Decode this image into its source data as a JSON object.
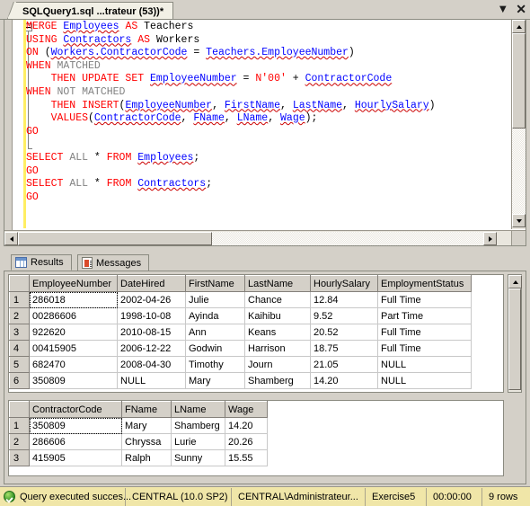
{
  "tab": {
    "title": "SQLQuery1.sql ...trateur (53))*",
    "dropdown_icon": "chevron-down-icon",
    "close_icon": "close-icon"
  },
  "editor": {
    "lines": [
      [
        {
          "t": "MERGE ",
          "c": "kw"
        },
        {
          "t": "Employees",
          "c": "id wavy-blue"
        },
        {
          "t": " AS ",
          "c": "kw"
        },
        {
          "t": "Teachers",
          "c": "op"
        }
      ],
      [
        {
          "t": "USING ",
          "c": "kw"
        },
        {
          "t": "Contractors",
          "c": "id wavy-blue"
        },
        {
          "t": " AS ",
          "c": "kw"
        },
        {
          "t": "Workers",
          "c": "op"
        }
      ],
      [
        {
          "t": "ON ",
          "c": "kw"
        },
        {
          "t": "(",
          "c": "op"
        },
        {
          "t": "Workers.ContractorCode",
          "c": "id wavy-blue"
        },
        {
          "t": " = ",
          "c": "op"
        },
        {
          "t": "Teachers.EmployeeNumber",
          "c": "id wavy-blue"
        },
        {
          "t": ")",
          "c": "op"
        }
      ],
      [
        {
          "t": "WHEN ",
          "c": "kw"
        },
        {
          "t": "MATCHED",
          "c": "kw2"
        }
      ],
      [
        {
          "t": "    THEN UPDATE SET ",
          "c": "kw"
        },
        {
          "t": "EmployeeNumber",
          "c": "id wavy-blue"
        },
        {
          "t": " = ",
          "c": "op"
        },
        {
          "t": "N'00'",
          "c": "str"
        },
        {
          "t": " + ",
          "c": "op"
        },
        {
          "t": "ContractorCode",
          "c": "id wavy-blue"
        }
      ],
      [
        {
          "t": "WHEN ",
          "c": "kw"
        },
        {
          "t": "NOT MATCHED",
          "c": "kw2"
        }
      ],
      [
        {
          "t": "    THEN INSERT",
          "c": "kw"
        },
        {
          "t": "(",
          "c": "op"
        },
        {
          "t": "EmployeeNumber",
          "c": "id wavy-blue"
        },
        {
          "t": ", ",
          "c": "op"
        },
        {
          "t": "FirstName",
          "c": "id wavy-blue"
        },
        {
          "t": ", ",
          "c": "op"
        },
        {
          "t": "LastName",
          "c": "id wavy-blue"
        },
        {
          "t": ", ",
          "c": "op"
        },
        {
          "t": "HourlySalary",
          "c": "id wavy-blue"
        },
        {
          "t": ")",
          "c": "op"
        }
      ],
      [
        {
          "t": "    VALUES",
          "c": "kw"
        },
        {
          "t": "(",
          "c": "op"
        },
        {
          "t": "ContractorCode",
          "c": "id wavy-blue"
        },
        {
          "t": ", ",
          "c": "op"
        },
        {
          "t": "FName",
          "c": "id wavy-blue"
        },
        {
          "t": ", ",
          "c": "op"
        },
        {
          "t": "LName",
          "c": "id wavy-blue"
        },
        {
          "t": ", ",
          "c": "op"
        },
        {
          "t": "Wage",
          "c": "id wavy-blue"
        },
        {
          "t": ");",
          "c": "op"
        }
      ],
      [
        {
          "t": "GO",
          "c": "kw"
        }
      ],
      [],
      [
        {
          "t": "SELECT ",
          "c": "kw"
        },
        {
          "t": "ALL",
          "c": "kw2"
        },
        {
          "t": " * ",
          "c": "op"
        },
        {
          "t": "FROM ",
          "c": "kw"
        },
        {
          "t": "Employees",
          "c": "id wavy-blue"
        },
        {
          "t": ";",
          "c": "op"
        }
      ],
      [
        {
          "t": "GO",
          "c": "kw"
        }
      ],
      [
        {
          "t": "SELECT ",
          "c": "kw"
        },
        {
          "t": "ALL",
          "c": "kw2"
        },
        {
          "t": " * ",
          "c": "op"
        },
        {
          "t": "FROM ",
          "c": "kw"
        },
        {
          "t": "Contractors",
          "c": "id wavy-blue"
        },
        {
          "t": ";",
          "c": "op"
        }
      ],
      [
        {
          "t": "GO",
          "c": "kw"
        }
      ]
    ]
  },
  "results_tabs": [
    {
      "label": "Results",
      "icon": "grid-icon",
      "active": true
    },
    {
      "label": "Messages",
      "icon": "message-icon",
      "active": false
    }
  ],
  "grids": [
    {
      "name": "employees-result-grid",
      "columns": [
        "EmployeeNumber",
        "DateHired",
        "FirstName",
        "LastName",
        "HourlySalary",
        "EmploymentStatus"
      ],
      "widths": [
        98,
        76,
        66,
        73,
        75,
        104
      ],
      "rows": [
        {
          "n": "1",
          "cells": [
            "286018",
            "2002-04-26",
            "Julie",
            "Chance",
            "12.84",
            "Full Time"
          ],
          "null_flags": [
            false,
            false,
            false,
            false,
            false,
            false
          ],
          "selected": 0
        },
        {
          "n": "2",
          "cells": [
            "00286606",
            "1998-10-08",
            "Ayinda",
            "Kaihibu",
            "9.52",
            "Part Time"
          ],
          "null_flags": [
            false,
            false,
            false,
            false,
            false,
            false
          ],
          "selected": -1
        },
        {
          "n": "3",
          "cells": [
            "922620",
            "2010-08-15",
            "Ann",
            "Keans",
            "20.52",
            "Full Time"
          ],
          "null_flags": [
            false,
            false,
            false,
            false,
            false,
            false
          ],
          "selected": -1
        },
        {
          "n": "4",
          "cells": [
            "00415905",
            "2006-12-22",
            "Godwin",
            "Harrison",
            "18.75",
            "Full Time"
          ],
          "null_flags": [
            false,
            false,
            false,
            false,
            false,
            false
          ],
          "selected": -1
        },
        {
          "n": "5",
          "cells": [
            "682470",
            "2008-04-30",
            "Timothy",
            "Journ",
            "21.05",
            "NULL"
          ],
          "null_flags": [
            false,
            false,
            false,
            false,
            false,
            true
          ],
          "selected": -1
        },
        {
          "n": "6",
          "cells": [
            "350809",
            "NULL",
            "Mary",
            "Shamberg",
            "14.20",
            "NULL"
          ],
          "null_flags": [
            false,
            true,
            false,
            false,
            false,
            true
          ],
          "selected": -1
        }
      ]
    },
    {
      "name": "contractors-result-grid",
      "columns": [
        "ContractorCode",
        "FName",
        "LName",
        "Wage"
      ],
      "widths": [
        103,
        55,
        60,
        47
      ],
      "rows": [
        {
          "n": "1",
          "cells": [
            "350809",
            "Mary",
            "Shamberg",
            "14.20"
          ],
          "null_flags": [
            false,
            false,
            false,
            false
          ],
          "selected": 0
        },
        {
          "n": "2",
          "cells": [
            "286606",
            "Chryssa",
            "Lurie",
            "20.26"
          ],
          "null_flags": [
            false,
            false,
            false,
            false
          ],
          "selected": -1
        },
        {
          "n": "3",
          "cells": [
            "415905",
            "Ralph",
            "Sunny",
            "15.55"
          ],
          "null_flags": [
            false,
            false,
            false,
            false
          ],
          "selected": -1
        }
      ]
    }
  ],
  "statusbar": {
    "status_icon": "success-check-icon",
    "status_text": "Query executed succes...",
    "server": "CENTRAL (10.0 SP2)",
    "user": "CENTRAL\\Administrateur...",
    "database": "Exercise5",
    "elapsed": "00:00:00",
    "rowcount": "9 rows"
  },
  "colors": {
    "keyword": "#ff0000",
    "identifier": "#0000ff",
    "secondary_keyword": "#808080",
    "null_cell_bg": "#ffffe0",
    "statusbar_bg": "#f0e6a8",
    "chrome_bg": "#d4d0c8"
  }
}
